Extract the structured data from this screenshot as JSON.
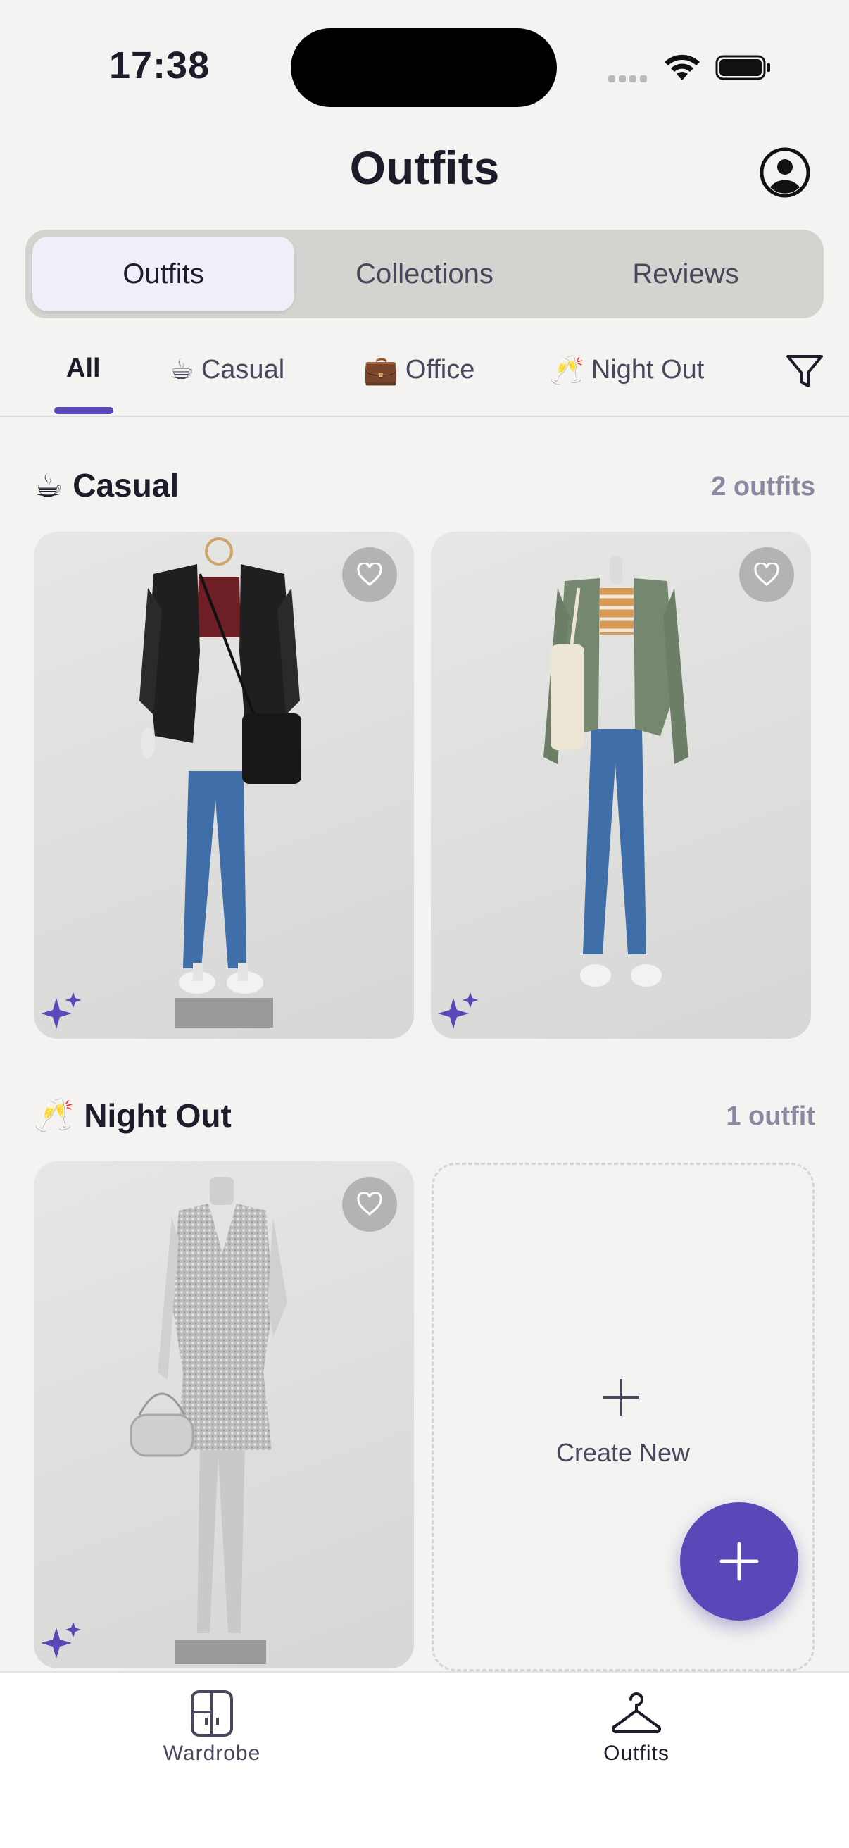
{
  "status_bar": {
    "time": "17:38"
  },
  "header": {
    "title": "Outfits",
    "profile_icon": "person-circle-icon"
  },
  "segmented": {
    "tabs": [
      "Outfits",
      "Collections",
      "Reviews"
    ],
    "active": "Outfits"
  },
  "filters": {
    "chips": [
      {
        "emoji": "",
        "label": "All"
      },
      {
        "emoji": "☕",
        "label": "Casual"
      },
      {
        "emoji": "💼",
        "label": "Office"
      },
      {
        "emoji": "🥂",
        "label": "Night Out"
      }
    ],
    "active": "All",
    "filter_icon": "funnel-icon"
  },
  "sections": [
    {
      "emoji": "☕",
      "title": "Casual",
      "count": "2 outfits"
    },
    {
      "emoji": "🥂",
      "title": "Night Out",
      "count": "1 outfit"
    }
  ],
  "create_card": {
    "label": "Create New"
  },
  "bottom_nav": {
    "items": [
      {
        "label": "Wardrobe",
        "icon": "wardrobe-icon"
      },
      {
        "label": "Outfits",
        "icon": "hanger-icon"
      }
    ],
    "active": "Outfits"
  },
  "colors": {
    "accent": "#5a47b8",
    "background": "#f4f3f1",
    "text": "#1d1c2b",
    "muted": "#8a88a0"
  }
}
